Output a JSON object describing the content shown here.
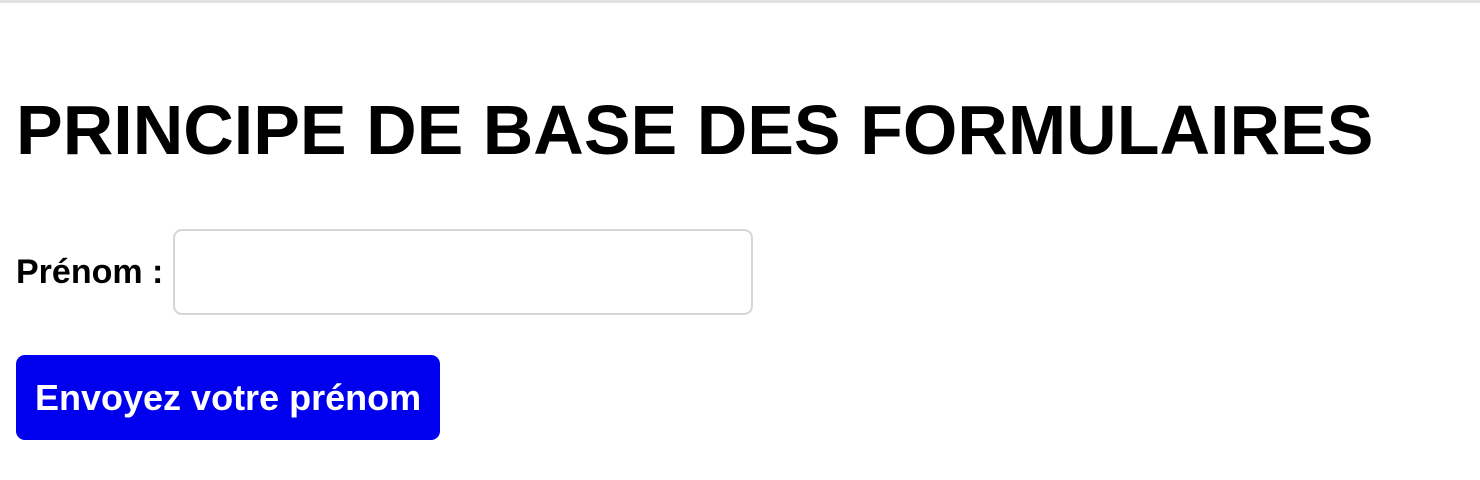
{
  "page": {
    "title": "PRINCIPE DE BASE DES FORMULAIRES"
  },
  "form": {
    "first_name_label": "Prénom :",
    "first_name_value": "",
    "submit_label": "Envoyez votre prénom"
  },
  "colors": {
    "button_background": "#0000ee",
    "button_text": "#ffffff",
    "input_border": "#d6d6d6",
    "top_rule": "#e2e2e2"
  }
}
